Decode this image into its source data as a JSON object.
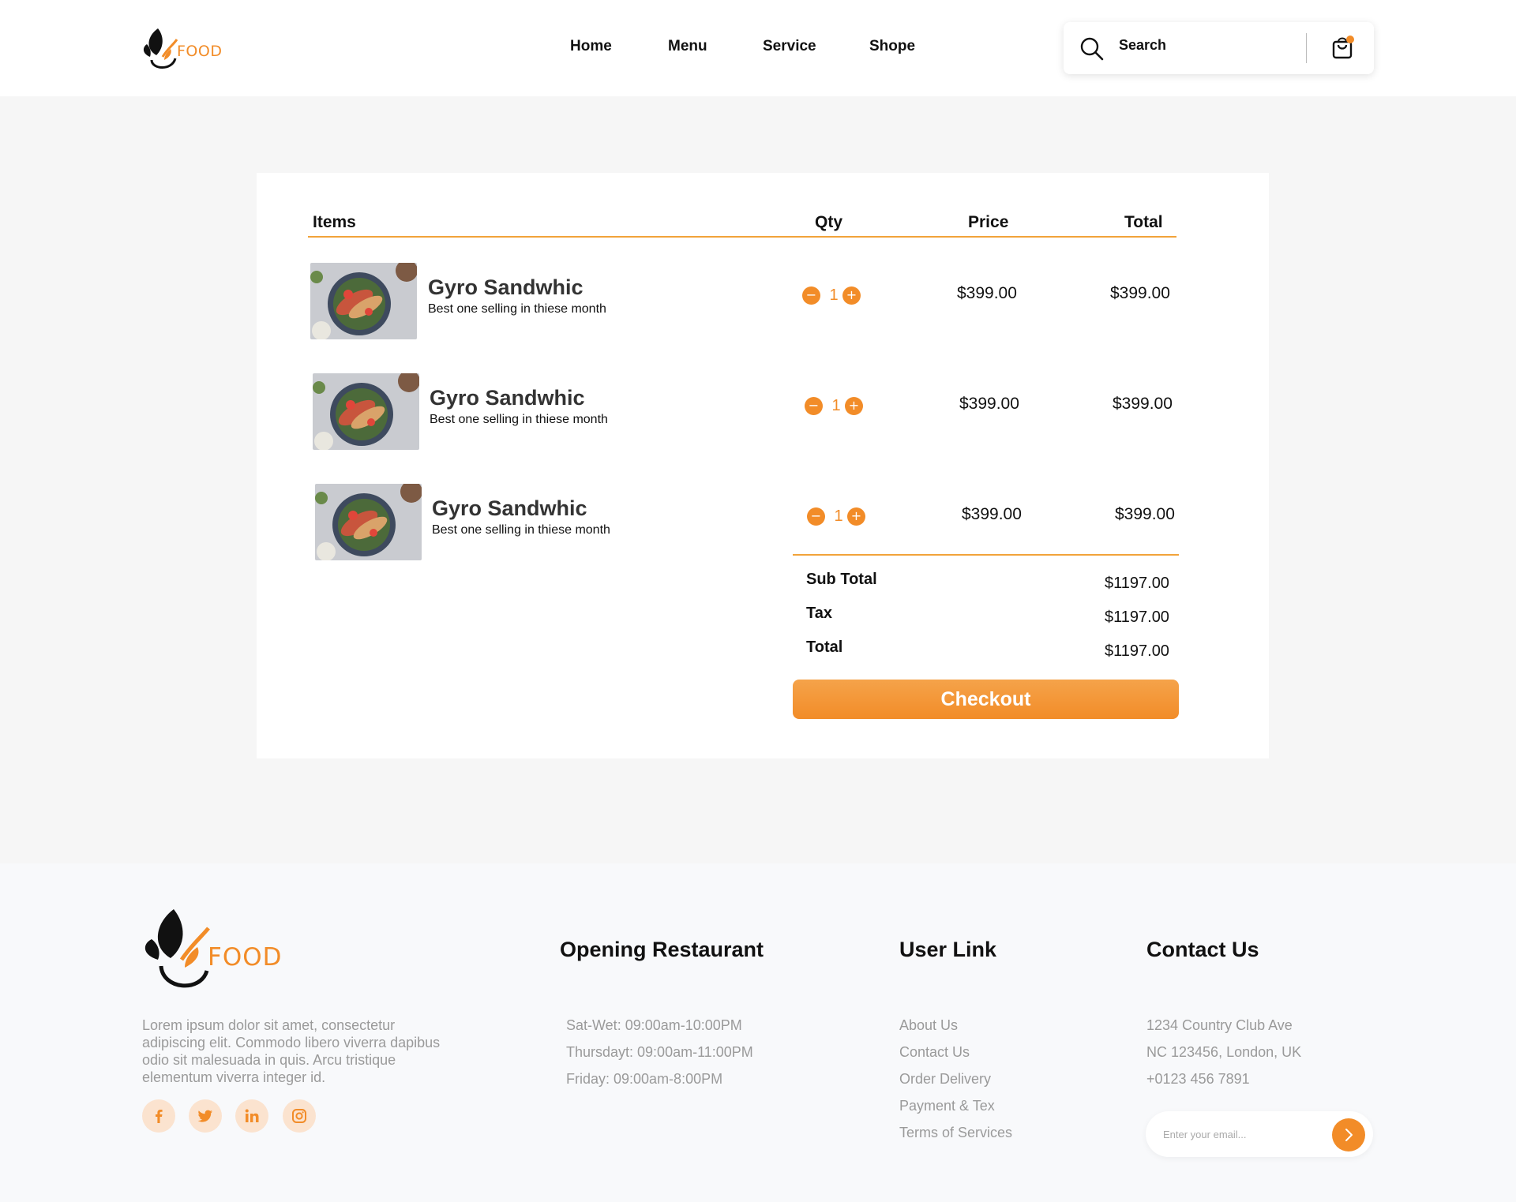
{
  "brand": {
    "logo_text": "FOOD",
    "accent_color": "#f28c28"
  },
  "header": {
    "nav": [
      "Home",
      "Menu",
      "Service",
      "Shope"
    ],
    "search_label": "Search"
  },
  "cart": {
    "columns": {
      "items": "Items",
      "qty": "Qty",
      "price": "Price",
      "total": "Total"
    },
    "items": [
      {
        "name": "Gyro Sandwhic",
        "description": "Best one selling in thiese month",
        "qty": "1",
        "price": "$399.00",
        "total": "$399.00"
      },
      {
        "name": "Gyro Sandwhic",
        "description": "Best one selling in thiese month",
        "qty": "1",
        "price": "$399.00",
        "total": "$399.00"
      },
      {
        "name": "Gyro Sandwhic",
        "description": "Best one selling in thiese month",
        "qty": "1",
        "price": "$399.00",
        "total": "$399.00"
      }
    ],
    "summary": {
      "subtotal_label": "Sub Total",
      "subtotal": "$1197.00",
      "tax_label": "Tax",
      "tax": "$1197.00",
      "total_label": "Total",
      "total": "$1197.00"
    },
    "checkout_label": "Checkout"
  },
  "footer": {
    "about": "Lorem ipsum dolor sit amet, consectetur adipiscing elit. Commodo libero viverra dapibus odio sit malesuada in quis. Arcu tristique elementum viverra integer id.",
    "social": [
      "facebook-icon",
      "twitter-icon",
      "linkedin-icon",
      "instagram-icon"
    ],
    "opening": {
      "title": "Opening Restaurant",
      "hours": [
        "Sat-Wet: 09:00am-10:00PM",
        "Thursdayt: 09:00am-11:00PM",
        "Friday: 09:00am-8:00PM"
      ]
    },
    "user_link": {
      "title": "User Link",
      "links": [
        "About Us",
        "Contact Us",
        "Order Delivery",
        "Payment & Tex",
        "Terms of Services"
      ]
    },
    "contact": {
      "title": "Contact Us",
      "lines": [
        "1234 Country Club Ave",
        "NC 123456, London, UK",
        "+0123 456 7891"
      ],
      "email_placeholder": "Enter your email..."
    }
  }
}
